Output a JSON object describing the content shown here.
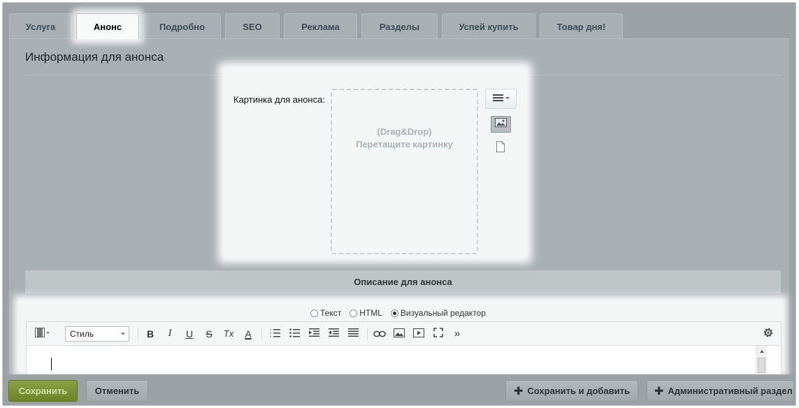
{
  "tabs": [
    {
      "label": "Услуга",
      "active": false
    },
    {
      "label": "Анонс",
      "active": true
    },
    {
      "label": "Подробно",
      "active": false
    },
    {
      "label": "SEO",
      "active": false
    },
    {
      "label": "Реклама",
      "active": false
    },
    {
      "label": "Разделы",
      "active": false
    },
    {
      "label": "Успей купить",
      "active": false
    },
    {
      "label": "Товар дня!",
      "active": false
    }
  ],
  "section_title": "Информация для анонса",
  "picture": {
    "label": "Картинка для анонса:",
    "dropzone_line1": "(Drag&Drop)",
    "dropzone_line2": "Перетащите картинку",
    "icons": [
      "menu-icon",
      "image-icon",
      "file-icon"
    ]
  },
  "description": {
    "header": "Описание для анонса",
    "modes": [
      {
        "label": "Текст",
        "selected": false
      },
      {
        "label": "HTML",
        "selected": false
      },
      {
        "label": "Визуальный редактор",
        "selected": true
      }
    ],
    "toolbar": {
      "style_select": "Стиль",
      "buttons": [
        "B",
        "I",
        "U",
        "S",
        "Tx",
        "A",
        "»"
      ]
    }
  },
  "buttons": {
    "save": "Сохранить",
    "cancel": "Отменить",
    "save_add": "Сохранить и добавить",
    "admin": "Административный раздел"
  },
  "colors": {
    "save_accent": "#7a922f",
    "overlay": "#9aa2a5",
    "highlight": "#f4f6f6"
  }
}
